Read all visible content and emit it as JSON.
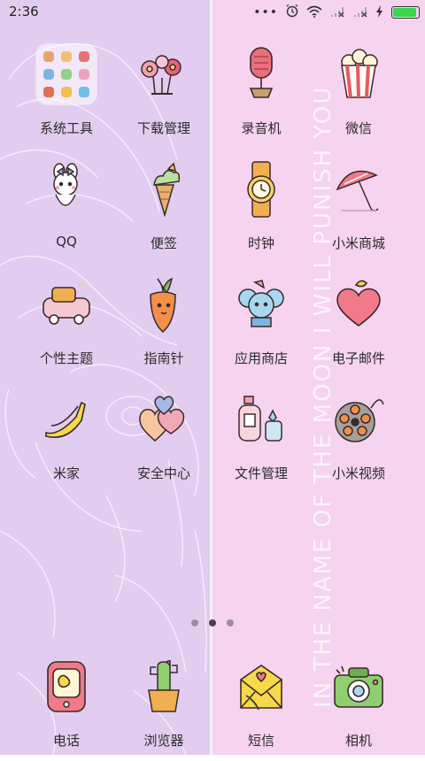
{
  "status_bar": {
    "time": "2:36",
    "battery_level": 1.0,
    "icons": [
      "more-dots-icon",
      "alarm-icon",
      "wifi-icon",
      "signal-icon",
      "signal-icon",
      "charging-icon",
      "battery-icon"
    ],
    "battery_color": "#3ad84a"
  },
  "wallpaper": {
    "vertical_text": "IN THE NAME OF THE MOON I WILL PUNISH YOU",
    "left_color": "#e2cdf0",
    "right_color": "#f6d3ef"
  },
  "apps": [
    {
      "label": "系统工具",
      "icon": "folder-icon"
    },
    {
      "label": "下载管理",
      "icon": "flowers-icon"
    },
    {
      "label": "录音机",
      "icon": "microphone-icon"
    },
    {
      "label": "微信",
      "icon": "popcorn-icon"
    },
    {
      "label": "QQ",
      "icon": "bunny-icon"
    },
    {
      "label": "便签",
      "icon": "ice-cream-cone-icon"
    },
    {
      "label": "时钟",
      "icon": "wristwatch-icon"
    },
    {
      "label": "小米商城",
      "icon": "umbrella-icon"
    },
    {
      "label": "个性主题",
      "icon": "car-icon"
    },
    {
      "label": "指南针",
      "icon": "carrot-icon"
    },
    {
      "label": "应用商店",
      "icon": "mouse-icon"
    },
    {
      "label": "电子邮件",
      "icon": "heart-icon"
    },
    {
      "label": "米家",
      "icon": "bananas-icon"
    },
    {
      "label": "安全中心",
      "icon": "hearts-icon"
    },
    {
      "label": "文件管理",
      "icon": "perfume-icon"
    },
    {
      "label": "小米视频",
      "icon": "film-reel-icon"
    }
  ],
  "pager": {
    "pages": 3,
    "current": 2
  },
  "dock": [
    {
      "label": "电话",
      "icon": "phone-icon"
    },
    {
      "label": "浏览器",
      "icon": "cactus-icon"
    },
    {
      "label": "短信",
      "icon": "envelope-icon"
    },
    {
      "label": "相机",
      "icon": "camera-icon"
    }
  ]
}
